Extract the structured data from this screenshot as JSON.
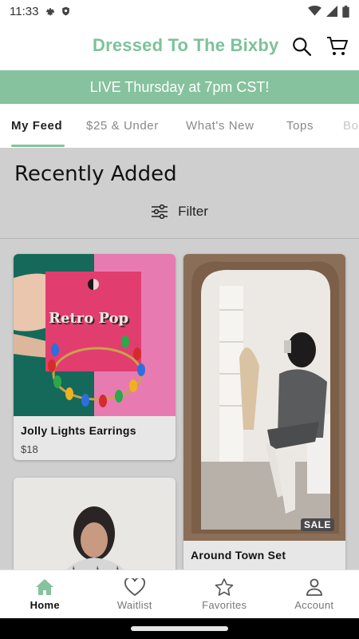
{
  "status_bar": {
    "time": "11:33",
    "left_icons": [
      "gear-icon",
      "shield-icon"
    ],
    "right_icons": [
      "wifi-icon",
      "signal-icon",
      "battery-icon"
    ]
  },
  "header": {
    "brand": "Dressed To The Bixby",
    "brand_color": "#7cc29a",
    "icons": [
      "search-icon",
      "cart-icon"
    ]
  },
  "announcement": {
    "text": "LIVE Thursday at 7pm CST!",
    "background": "#86c29d"
  },
  "tabs": [
    {
      "label": "My Feed",
      "active": true
    },
    {
      "label": "$25 & Under",
      "active": false
    },
    {
      "label": "What's New",
      "active": false
    },
    {
      "label": "Tops",
      "active": false
    },
    {
      "label": "Bo",
      "active": false
    }
  ],
  "feed": {
    "section_title": "Recently Added",
    "filter_label": "Filter",
    "filter_icon": "sliders-icon"
  },
  "products": [
    {
      "name": "Jolly Lights Earrings",
      "price": "$18",
      "image": "earrings-photo",
      "sale": false,
      "card_text": "Retro Pop"
    },
    {
      "name": "Around Town Set",
      "price": "",
      "image": "mirror-selfie-photo",
      "sale": true,
      "badge": "SALE"
    },
    {
      "name": "",
      "price": "",
      "image": "woman-plaid-shirt-photo",
      "sale": false
    }
  ],
  "bottom_nav": {
    "items": [
      {
        "label": "Home",
        "icon": "home-icon",
        "active": true
      },
      {
        "label": "Waitlist",
        "icon": "heart-icon",
        "active": false
      },
      {
        "label": "Favorites",
        "icon": "star-icon",
        "active": false
      },
      {
        "label": "Account",
        "icon": "person-icon",
        "active": false
      }
    ],
    "active_color": "#86c29d"
  }
}
